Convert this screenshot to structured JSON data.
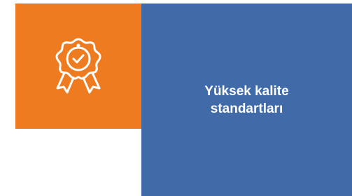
{
  "feature": {
    "icon": "award-badge-check-icon",
    "title_line1": "Yüksek kalite",
    "title_line2": "standartları"
  },
  "colors": {
    "icon_background": "#ee7b1f",
    "panel_background": "#416aa8",
    "text": "#ffffff",
    "icon_stroke": "#ffffff"
  }
}
